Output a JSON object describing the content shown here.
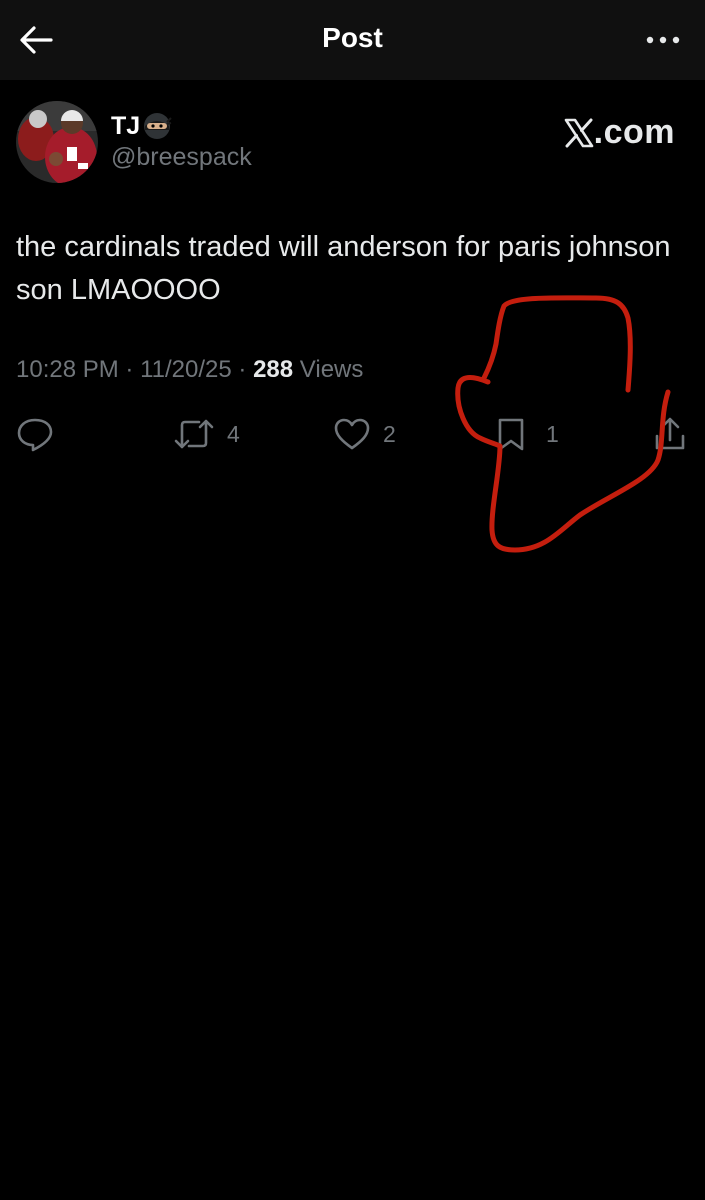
{
  "header": {
    "title": "Post",
    "back_icon": "arrow-left-icon",
    "more_icon": "more-horizontal-icon"
  },
  "post": {
    "author": {
      "display_name": "TJ",
      "emoji": "ninja-emoji",
      "handle": "@breespack"
    },
    "watermark": ".com",
    "text": "the cardinals traded will anderson for paris johnson son LMAOOOO",
    "time": "10:28 PM",
    "date": "11/20/25",
    "views_count": "288",
    "views_label": "Views",
    "separator": "·",
    "actions": {
      "reply": {
        "icon": "reply-icon",
        "count": ""
      },
      "repost": {
        "icon": "repost-icon",
        "count": "4"
      },
      "like": {
        "icon": "heart-icon",
        "count": "2"
      },
      "bookmark": {
        "icon": "bookmark-icon",
        "count": "1"
      },
      "share": {
        "icon": "share-icon",
        "count": ""
      }
    }
  },
  "colors": {
    "background": "#000000",
    "header": "#101010",
    "text": "#e7e9ea",
    "muted": "#71767b",
    "annotation": "#c41e0e"
  }
}
